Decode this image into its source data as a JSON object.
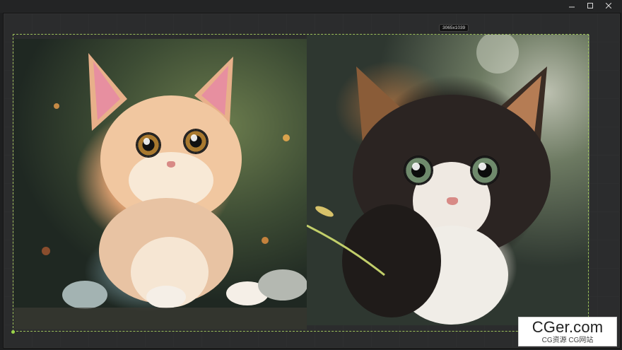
{
  "window": {
    "controls": [
      "minimize-icon",
      "maximize-icon",
      "close-icon"
    ]
  },
  "canvas": {
    "dimension_badge": "3065x1039",
    "images": [
      {
        "name": "orange-kitten"
      },
      {
        "name": "calico-kitten"
      }
    ]
  },
  "watermark": {
    "main": "CGer.com",
    "sub": "CG资源 CG网站"
  },
  "colors": {
    "selection_border": "#9bbf5a",
    "handle": "#9bd34a",
    "background": "#1e1f20"
  }
}
